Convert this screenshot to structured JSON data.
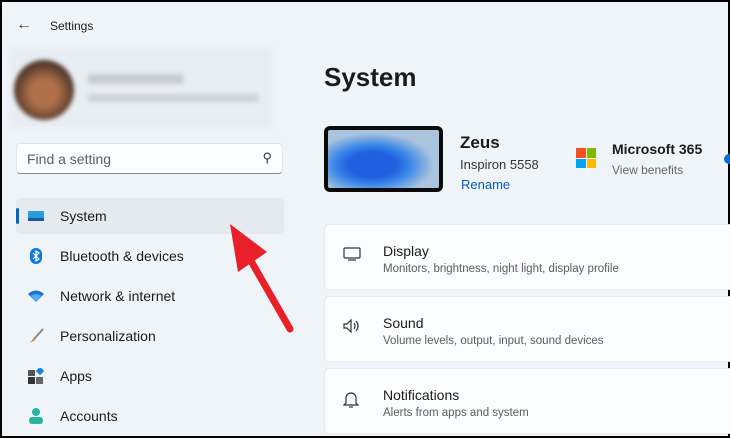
{
  "app": {
    "title": "Settings"
  },
  "search": {
    "placeholder": "Find a setting"
  },
  "nav": [
    {
      "label": "System"
    },
    {
      "label": "Bluetooth & devices"
    },
    {
      "label": "Network & internet"
    },
    {
      "label": "Personalization"
    },
    {
      "label": "Apps"
    },
    {
      "label": "Accounts"
    }
  ],
  "page": {
    "title": "System"
  },
  "device": {
    "name": "Zeus",
    "model": "Inspiron 5558",
    "rename": "Rename"
  },
  "ms365": {
    "title": "Microsoft 365",
    "subtitle": "View benefits"
  },
  "cards": [
    {
      "title": "Display",
      "subtitle": "Monitors, brightness, night light, display profile"
    },
    {
      "title": "Sound",
      "subtitle": "Volume levels, output, input, sound devices"
    },
    {
      "title": "Notifications",
      "subtitle": "Alerts from apps and system"
    }
  ],
  "colors": {
    "accent": "#0067c0",
    "arrow": "#e8202a"
  }
}
